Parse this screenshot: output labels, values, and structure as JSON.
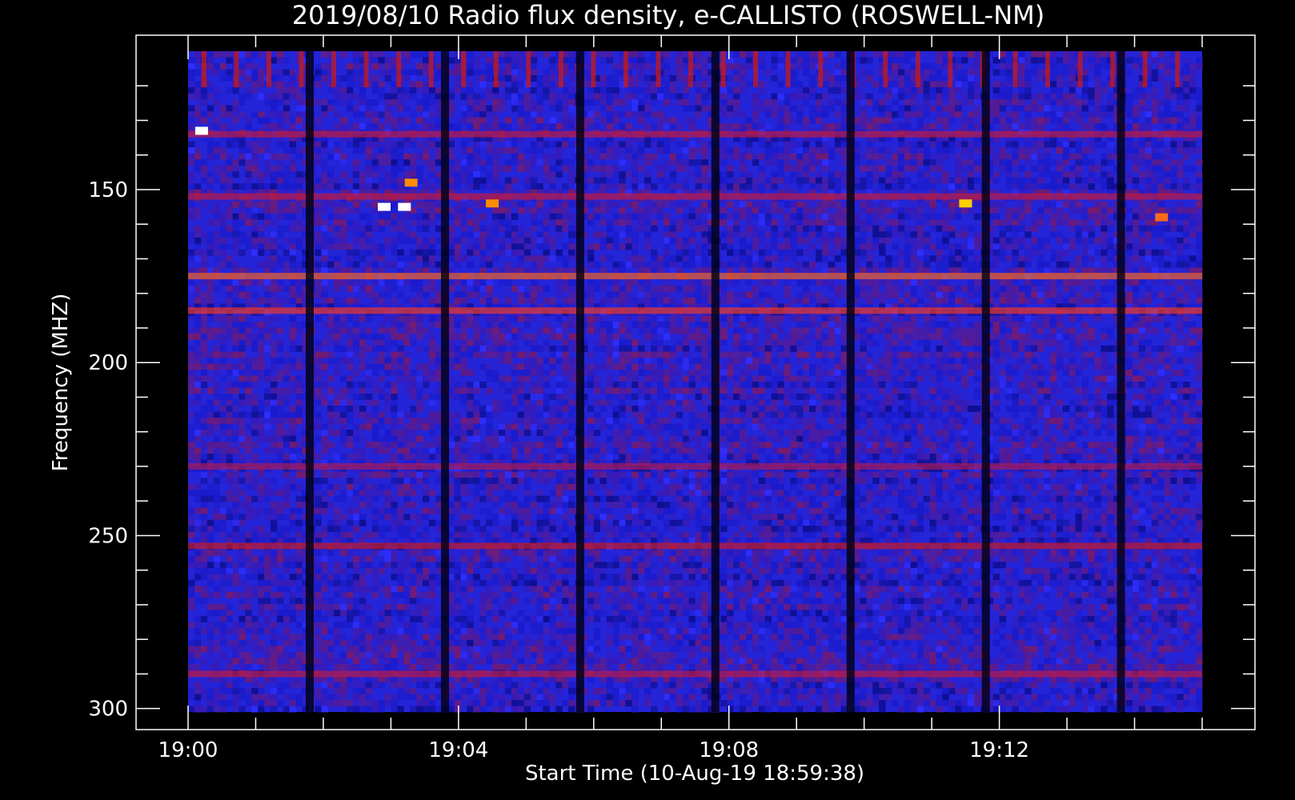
{
  "chart_data": {
    "type": "heatmap",
    "title": "2019/08/10  Radio flux density, e-CALLISTO (ROSWELL-NM)",
    "xlabel": "Start Time (10-Aug-19 18:59:38)",
    "ylabel": "Frequency (MHZ)",
    "x_ticks": [
      "19:00",
      "19:04",
      "19:08",
      "19:12"
    ],
    "y_ticks": [
      150,
      200,
      250,
      300
    ],
    "x_range_minutes": [
      0,
      15
    ],
    "y_range_mhz": [
      110,
      301
    ],
    "y_axis_inverted": true,
    "colormap": [
      "#000000",
      "#1a1acc",
      "#2a2aff",
      "#8a1a6a",
      "#d41a1a",
      "#ff8c00",
      "#ffffff"
    ],
    "background_level": "#2424d8",
    "vertical_dark_bands_minutes": [
      1.8,
      3.8,
      5.8,
      7.8,
      9.8,
      11.8,
      13.8
    ],
    "horizontal_bands_mhz": [
      {
        "mhz": 134,
        "color": "#c81a3a"
      },
      {
        "mhz": 152,
        "color": "#c81a3a"
      },
      {
        "mhz": 175,
        "color": "#ff6a1a"
      },
      {
        "mhz": 185,
        "color": "#ff3a1a"
      },
      {
        "mhz": 230,
        "color": "#b01a50"
      },
      {
        "mhz": 253,
        "color": "#d41a1a"
      },
      {
        "mhz": 290,
        "color": "#c81a3a"
      }
    ],
    "bursts": [
      {
        "t_min": 2.9,
        "mhz": 155,
        "color": "#ffffff"
      },
      {
        "t_min": 3.2,
        "mhz": 155,
        "color": "#ffffff"
      },
      {
        "t_min": 3.3,
        "mhz": 148,
        "color": "#ff8c00"
      },
      {
        "t_min": 4.5,
        "mhz": 154,
        "color": "#ff8c00"
      },
      {
        "t_min": 0.2,
        "mhz": 133,
        "color": "#ffffff"
      },
      {
        "t_min": 11.5,
        "mhz": 154,
        "color": "#ffd000"
      },
      {
        "t_min": 14.4,
        "mhz": 158,
        "color": "#ff6a1a"
      }
    ]
  }
}
